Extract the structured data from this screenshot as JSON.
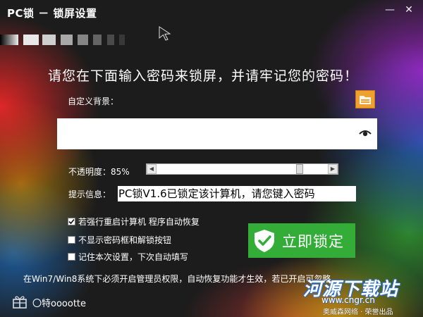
{
  "window": {
    "title": "PC锁 － 锁屏设置",
    "min_glyph": "—",
    "close_glyph": "✕"
  },
  "main": {
    "headline": "请您在下面输入密码来锁屏，并请牢记您的密码！",
    "bg_label": "自定义背景：",
    "password_value": "",
    "opacity_label": "不透明度：85%",
    "opacity_value": 85,
    "hint_label": "提示信息：",
    "hint_value": "PC锁V1.6已锁定该计算机，请您键入密码",
    "options": [
      {
        "label": "若强行重启计算机 程序自动恢复",
        "checked": true
      },
      {
        "label": "不显示密码框和解锁按钮",
        "checked": false
      },
      {
        "label": "记住本次设置，下次自动填写",
        "checked": false
      }
    ],
    "lock_button_label": "立即锁定",
    "notice": "在Win7/Win8系统下必须开启管理员权限，自动恢复功能才生效，若已开启可忽略。"
  },
  "footer": {
    "brand": "〇特ooootte"
  },
  "watermark": {
    "main": "河源下载站",
    "url": "www.cngr.cn",
    "sub": "奥威森网络 · 荣誉出品"
  },
  "colors": {
    "lock_button": "#33ad38",
    "folder_button": "#f0a030",
    "background": "#1c1c1c"
  },
  "icons": {
    "folder": "folder-icon",
    "eye": "eye-icon",
    "shield": "shield-check-icon",
    "footer": "gift-icon"
  }
}
